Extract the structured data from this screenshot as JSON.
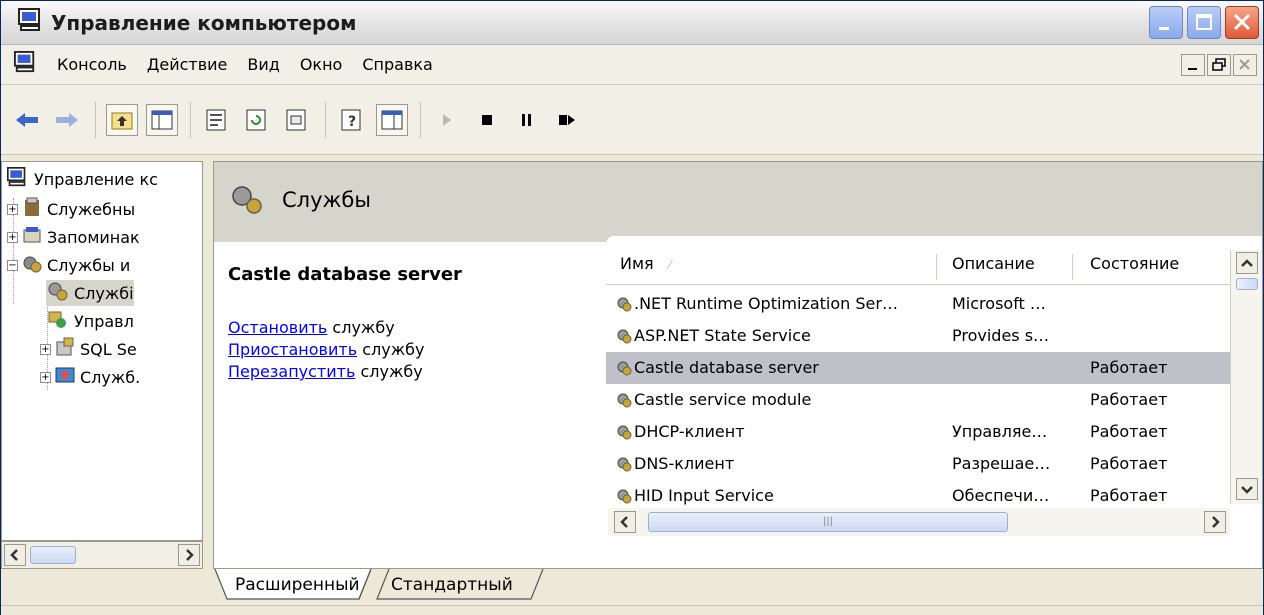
{
  "window": {
    "title": "Управление компьютером"
  },
  "menu": [
    "Консоль",
    "Действие",
    "Вид",
    "Окно",
    "Справка"
  ],
  "toolbar": {
    "icons": [
      "back-icon",
      "forward-icon",
      "up-icon",
      "show-tree-icon",
      "properties-icon",
      "refresh-icon",
      "export-icon",
      "help-icon",
      "console-icon",
      "play-icon",
      "stop-icon",
      "pause-icon",
      "restart-icon"
    ]
  },
  "tree": {
    "items": [
      {
        "label": "Управление кс",
        "expander": ""
      },
      {
        "label": "Служебны",
        "expander": "+"
      },
      {
        "label": "Запоминак",
        "expander": "+"
      },
      {
        "label": "Службы и",
        "expander": "−"
      },
      {
        "label": "Службі",
        "expander": ""
      },
      {
        "label": "Управл",
        "expander": ""
      },
      {
        "label": "SQL Se",
        "expander": "+"
      },
      {
        "label": "Служб.",
        "expander": "+"
      }
    ]
  },
  "panel": {
    "header": "Службы",
    "service_name": "Castle database server",
    "actions": [
      {
        "link": "Остановить",
        "suffix": " службу"
      },
      {
        "link": "Приостановить",
        "suffix": " службу"
      },
      {
        "link": "Перезапустить",
        "suffix": " службу"
      }
    ]
  },
  "list": {
    "columns": [
      "Имя",
      "Описание",
      "Состояние"
    ],
    "rows": [
      {
        "name": ".NET Runtime Optimization Ser…",
        "description": "Microsoft …",
        "state": "",
        "selected": false
      },
      {
        "name": "ASP.NET State Service",
        "description": "Provides s…",
        "state": "",
        "selected": false
      },
      {
        "name": "Castle database server",
        "description": "",
        "state": "Работает",
        "selected": true
      },
      {
        "name": "Castle service module",
        "description": "",
        "state": "Работает",
        "selected": false
      },
      {
        "name": "DHCP-клиент",
        "description": "Управляе…",
        "state": "Работает",
        "selected": false
      },
      {
        "name": "DNS-клиент",
        "description": "Разрешае…",
        "state": "Работает",
        "selected": false
      },
      {
        "name": "HID Input Service",
        "description": "Обеспечи…",
        "state": "Работает",
        "selected": false
      }
    ]
  },
  "tabs": [
    "Расширенный",
    "Стандартный"
  ]
}
